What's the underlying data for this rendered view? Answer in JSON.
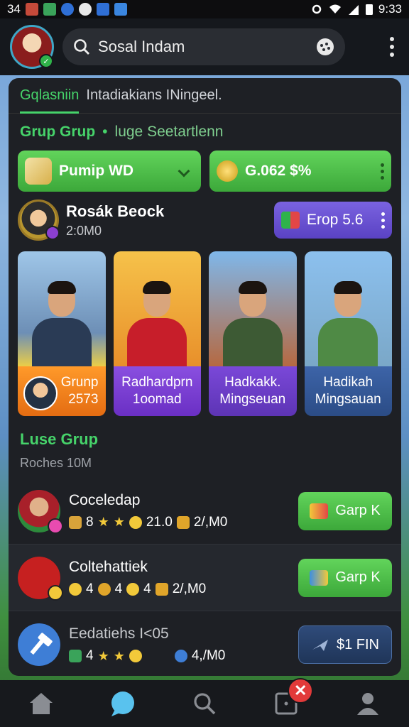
{
  "status_bar": {
    "left_text": "34",
    "time": "9:33"
  },
  "top_bar": {
    "search_text": "Sosal Indam"
  },
  "tabs": {
    "active": "Gqlasniin",
    "other": "Intadiakians INingeel."
  },
  "section": {
    "title": "Grup Grup",
    "separator": "•",
    "subtitle": "luge Seetartlenn"
  },
  "buttons": {
    "left_label": "Pumip WD",
    "right_label": "G.062 $%"
  },
  "profile": {
    "name": "Rosák Beock",
    "sub": "2:0M0",
    "action_label": "Erop 5.6"
  },
  "cards": [
    {
      "line1": "Grunp",
      "line2": "2573"
    },
    {
      "line1": "Radhardprn",
      "line2": "1oomad"
    },
    {
      "line1": "Hadkakk.",
      "line2": "Mingseuan"
    },
    {
      "line1": "Hadikah",
      "line2": "Mingsauan"
    }
  ],
  "list": {
    "title": "Luse Grup",
    "subtitle": "Roches 10M",
    "rows": [
      {
        "name": "Coceledap",
        "stat_a": "8",
        "stat_b": "21.0",
        "stat_c": "2/,M0",
        "button_label": "Garp K"
      },
      {
        "name": "Coltehattiek",
        "stat_a": "4",
        "stat_b": "4",
        "stat_c": "4",
        "stat_d": "2/,M0",
        "button_label": "Garp K"
      },
      {
        "name": "Eedatiehs I<05",
        "stat_a": "4",
        "stat_c": "4,/M0",
        "button_label": "$1 FIN"
      }
    ]
  },
  "colors": {
    "accent_green": "#46d36a",
    "panel_bg": "#1e2025",
    "purple": "#6a4fd8",
    "close_red": "#e23a3a"
  }
}
